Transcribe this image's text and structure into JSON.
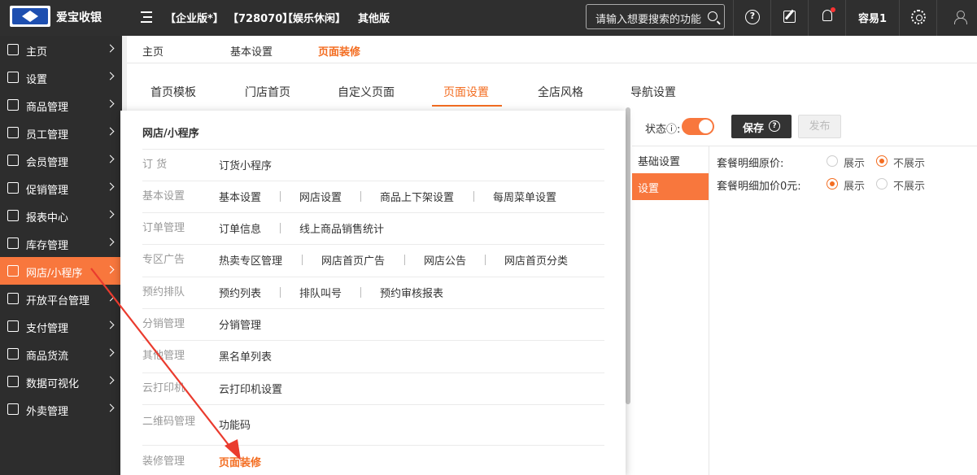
{
  "header": {
    "app_name": "爱宝收银",
    "edition": "【企业版*】",
    "code": "【728070】",
    "industry": "【娱乐休闲】",
    "other": "其他版",
    "search_placeholder": "请输入想要搜索的功能",
    "user_name": "容易1"
  },
  "sidebar": {
    "items": [
      {
        "label": "主页",
        "icon": "home-icon"
      },
      {
        "label": "设置",
        "icon": "settings-icon"
      },
      {
        "label": "商品管理",
        "icon": "barcode-icon"
      },
      {
        "label": "员工管理",
        "icon": "staff-icon"
      },
      {
        "label": "会员管理",
        "icon": "member-card-icon"
      },
      {
        "label": "促销管理",
        "icon": "check-circle-icon"
      },
      {
        "label": "报表中心",
        "icon": "bar-chart-icon"
      },
      {
        "label": "库存管理",
        "icon": "pie-chart-icon"
      },
      {
        "label": "网店/小程序",
        "icon": "store-icon"
      },
      {
        "label": "开放平台管理",
        "icon": "monitor-icon"
      },
      {
        "label": "支付管理",
        "icon": "yuan-icon"
      },
      {
        "label": "商品货流",
        "icon": "cube-icon"
      },
      {
        "label": "数据可视化",
        "icon": "line-chart-icon"
      },
      {
        "label": "外卖管理",
        "icon": "grid-icon"
      }
    ],
    "active_index": 8
  },
  "top_tabs": [
    "主页",
    "基本设置",
    "页面装修"
  ],
  "page_tabs": [
    "首页模板",
    "门店首页",
    "自定义页面",
    "页面设置",
    "全店风格",
    "导航设置"
  ],
  "dropdown": {
    "title": "网店/小程序",
    "rows": [
      {
        "category": "订 货",
        "items": [
          "订货小程序"
        ]
      },
      {
        "category": "基本设置",
        "items": [
          "基本设置",
          "网店设置",
          "商品上下架设置",
          "每周菜单设置"
        ]
      },
      {
        "category": "订单管理",
        "items": [
          "订单信息",
          "线上商品销售统计"
        ]
      },
      {
        "category": "专区广告",
        "items": [
          "热卖专区管理",
          "网店首页广告",
          "网店公告",
          "网店首页分类"
        ]
      },
      {
        "category": "预约排队",
        "items": [
          "预约列表",
          "排队叫号",
          "预约审核报表"
        ]
      },
      {
        "category": "分销管理",
        "items": [
          "分销管理"
        ]
      },
      {
        "category": "其他管理",
        "items": [
          "黑名单列表"
        ]
      },
      {
        "category": "云打印机",
        "items": [
          "云打印机设置"
        ]
      },
      {
        "category": "二维码管理",
        "items": [
          "功能码"
        ]
      },
      {
        "category": "装修管理",
        "items": [
          "页面装修"
        ]
      }
    ]
  },
  "right_panel": {
    "status_label": "状态",
    "save_label": "保存",
    "publish_label": "发布",
    "sub_nav": [
      "基础设置",
      "设置"
    ],
    "options": [
      {
        "label": "套餐明细原价:",
        "choices": [
          "展示",
          "不展示"
        ],
        "selected": 1
      },
      {
        "label": "套餐明细加价0元:",
        "choices": [
          "展示",
          "不展示"
        ],
        "selected": 0
      }
    ]
  },
  "colors": {
    "accent": "#f8773d",
    "active_text": "#f36d21",
    "header_bg": "#2f2f2f",
    "sidebar_bg": "#2d2d2d"
  }
}
